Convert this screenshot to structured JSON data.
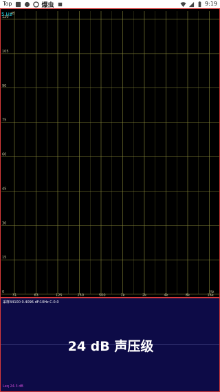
{
  "status_bar": {
    "left_label": "Top",
    "app_name": "爆虫",
    "time": "9:19",
    "icons": [
      "notification-icon",
      "notification-icon",
      "notification-icon",
      "app-icon",
      "wifi-icon",
      "signal-icon",
      "battery-icon"
    ]
  },
  "spectrum": {
    "y_unit": "dB",
    "freq_readout": "5 Hz",
    "x_unit": "Hz",
    "y_ticks": [
      "120",
      "105",
      "90",
      "75",
      "60",
      "45",
      "30",
      "15",
      "0"
    ],
    "x_ticks": [
      "31",
      "63",
      "125",
      "250",
      "500",
      "1k",
      "2k",
      "4k",
      "8k",
      "16k"
    ],
    "colors": {
      "background": "#000000",
      "grid": "#8a8a3a",
      "tick_text": "#c8c8a0",
      "freq_readout": "#22d8e8",
      "border": "#d83a3a"
    }
  },
  "bottom_panel": {
    "info_line": "采样44100 0.4096 dF:10Hz C-0.0",
    "spl_readout": "24 dB 声压级",
    "leq": "Leq 24.3 dB",
    "colors": {
      "background": "#0d0b47",
      "leq_text": "#d04ad8"
    }
  }
}
